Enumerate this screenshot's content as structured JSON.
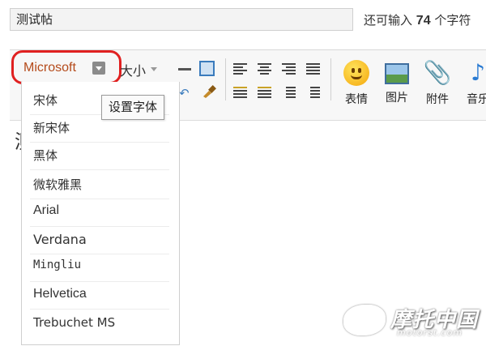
{
  "title": {
    "value": "测试帖",
    "counter_prefix": "还可输入",
    "counter_value": "74",
    "counter_suffix": "个字符"
  },
  "editor": {
    "first_char": "测"
  },
  "toolbar": {
    "font_select_value": "Microsoft",
    "size_select_label": "大小",
    "tooltip": "设置字体",
    "big_buttons": [
      {
        "label": "表情",
        "icon": "smiley-icon"
      },
      {
        "label": "图片",
        "icon": "image-icon"
      },
      {
        "label": "附件",
        "icon": "paperclip-icon"
      },
      {
        "label": "音乐",
        "icon": "music-note-icon"
      }
    ]
  },
  "font_list": {
    "items": [
      "宋体",
      "新宋体",
      "黑体",
      "微软雅黑",
      "Arial",
      "Verdana",
      "Mingliu",
      "Helvetica",
      "Trebuchet MS"
    ]
  },
  "watermark": {
    "cn": "摩托中国",
    "en": "motorst.com"
  },
  "colors": {
    "highlight_ring": "#e02020",
    "font_select_text": "#b44a1a"
  }
}
